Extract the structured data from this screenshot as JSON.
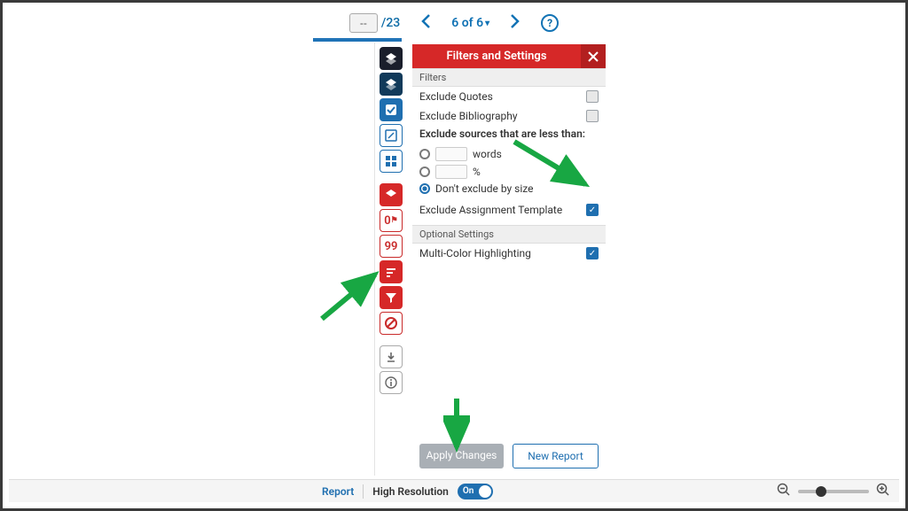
{
  "colors": {
    "accent_blue": "#1f6fb0",
    "accent_red": "#d62828"
  },
  "topbar": {
    "page_input": "--",
    "page_total": "/23",
    "match_text": "6 of 6",
    "help": "?"
  },
  "toolbar": {
    "flag_badge": "0",
    "similarity": "99"
  },
  "panel": {
    "title": "Filters and Settings",
    "section_filters": "Filters",
    "exclude_quotes": "Exclude Quotes",
    "exclude_bibliography": "Exclude Bibliography",
    "exclude_size_label": "Exclude sources that are less than:",
    "words_label": "words",
    "percent_label": "%",
    "dont_exclude_label": "Don't exclude by size",
    "exclude_template": "Exclude Assignment Template",
    "section_optional": "Optional Settings",
    "multicolor": "Multi-Color Highlighting"
  },
  "radio_selected": "dont_exclude",
  "checkboxes": {
    "exclude_quotes": false,
    "exclude_bibliography": false,
    "exclude_template": true,
    "multicolor": true
  },
  "actions": {
    "apply": "Apply Changes",
    "new_report": "New Report"
  },
  "footer": {
    "report": "Report",
    "highres": "High Resolution",
    "toggle_label": "On",
    "toggle_state": true
  }
}
